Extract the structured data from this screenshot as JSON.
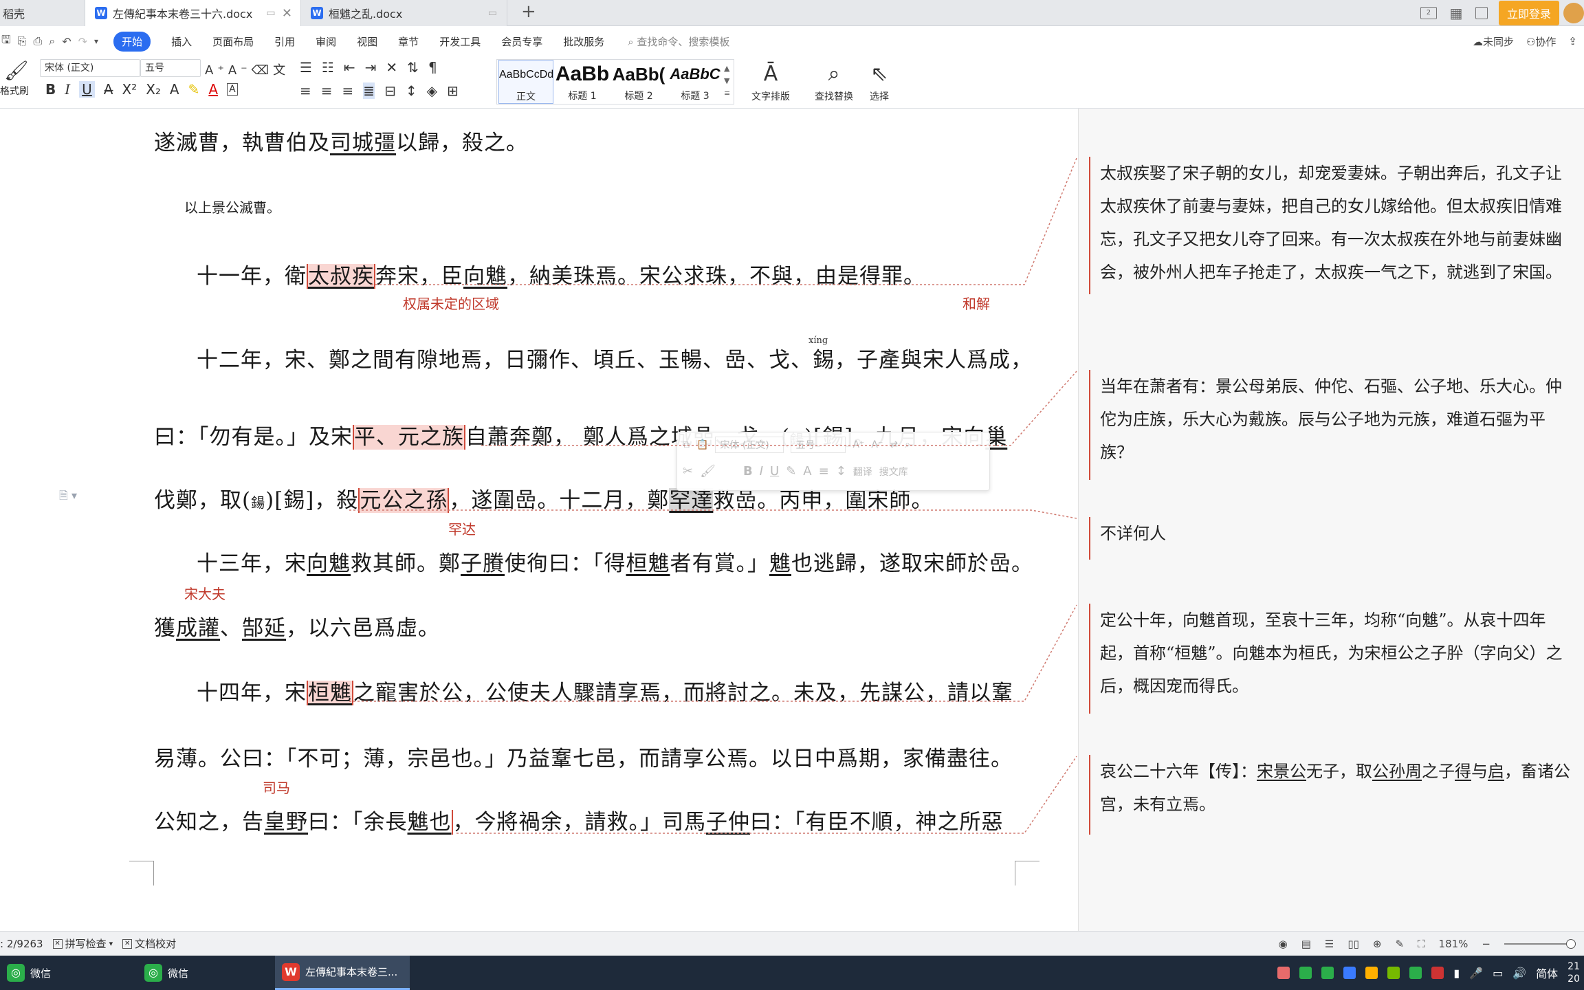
{
  "tabs": {
    "home_label": "稻壳",
    "doc1_label": "左傳紀事本末卷三十六.docx",
    "doc2_label": "桓魋之乱.docx",
    "new_tab": "+"
  },
  "titlebar": {
    "login_label": "立即登录",
    "layout_badge": "2"
  },
  "menu": {
    "items": [
      "开始",
      "插入",
      "页面布局",
      "引用",
      "审阅",
      "视图",
      "章节",
      "开发工具",
      "会员专享",
      "批改服务"
    ],
    "search_placeholder": "查找命令、搜索模板",
    "sync_label": "未同步",
    "collab_label": "协作"
  },
  "ribbon": {
    "format_painter": "格式刷",
    "font_name": "宋体 (正文)",
    "font_size": "五号",
    "styles": [
      {
        "preview": "AaBbCcDd",
        "name": "正文"
      },
      {
        "preview": "AaBb",
        "name": "标题 1"
      },
      {
        "preview": "AaBb(",
        "name": "标题 2"
      },
      {
        "preview": "AaBbC",
        "name": "标题 3"
      }
    ],
    "text_layout": "文字排版",
    "find_replace": "查找替换",
    "select": "选择"
  },
  "doc": {
    "l1_a": "遂滅曹，執曹伯及",
    "l1_u1": "司城彊",
    "l1_b": "以歸，殺之。",
    "note1": "以上景公滅曹。",
    "l2_a": "十一年，衛",
    "l2_h1": "太叔疾",
    "l2_b": "奔宋，臣",
    "l2_u1": "向魋",
    "l2_c": "，納美珠焉。宋公求珠，不與，由是得罪。",
    "anno_region": "权属未定的区域",
    "anno_peace": "和解",
    "l3_a": "十二年，宋、鄭之間有隙地焉，日彌作、頃丘、玉暢、嵒、戈、",
    "l3_b": "錫",
    "l3_c": "，子產與宋人爲成，",
    "ruby_xing": "xíng",
    "l4_a": "曰：「勿有是。」及宋",
    "l4_h1": "平、元之族",
    "l4_b": "自蕭奔鄭，  鄭人爲之城嵒、戈、(",
    "l4_small": "鍚",
    "l4_c": ")[錫]。九月，宋向",
    "l4_u1": "巢",
    "l5_a": "伐鄭，取(",
    "l5_small": "鍚",
    "l5_b": ")[錫]，殺",
    "l5_h1": "元公之孫",
    "l5_c": "，遂圍嵒。十二月，鄭",
    "l5_u1": "罕達",
    "l5_d": "救嵒。丙申，圍宋師。",
    "anno_handa": "罕达",
    "l6_a": "十三年，宋",
    "l6_u1": "向魋",
    "l6_b": "救其師。鄭",
    "l6_u2": "子賸",
    "l6_c": "使徇曰：「得",
    "l6_u3": "桓魋",
    "l6_d": "者有賞。」",
    "l6_u4": "魋",
    "l6_e": "也逃歸，遂取宋師於嵒。",
    "anno_song": "宋大夫",
    "l7_a": "獲",
    "l7_u1": "成讙",
    "l7_b": "、",
    "l7_u2": "郜延",
    "l7_c": "，以六邑爲虛。",
    "l8_a": "十四年，宋",
    "l8_h1": "桓魋",
    "l8_b": "之寵害於公，公使夫人驟請享焉，而將討之。未及，先謀公，請以鞌",
    "l9": "易薄。公曰：「不可；薄，宗邑也。」乃益鞌七邑，而請享公焉。以日中爲期，家備盡往。",
    "anno_sima": "司马",
    "l10_a": "公知之，告",
    "l10_u1": "皇野",
    "l10_b": "曰：「余長",
    "l10_u2": "魋也",
    "l10_c": "，今將禍余，請救。」司馬",
    "l10_u3": "子仲",
    "l10_d": "曰：「有臣不順，神之所惡"
  },
  "minibar": {
    "font": "宋体 (正文)",
    "size": "五号",
    "translate": "翻译",
    "search_lib": "搜文库"
  },
  "comments": {
    "c1": "太叔疾娶了宋子朝的女儿，却宠爱妻妹。子朝出奔后，孔文子让太叔疾休了前妻与妻妹，把自己的女儿嫁给他。但太叔疾旧情难忘，孔文子又把女儿夺了回来。有一次太叔疾在外地与前妻妹幽会，被外州人把车子抢走了，太叔疾一气之下，就逃到了宋国。",
    "c2": "当年在萧者有：景公母弟辰、仲佗、石彄、公子地、乐大心。仲佗为庄族，乐大心为戴族。辰与公子地为元族，难道石彄为平族？",
    "c3": "不详何人",
    "c4": "定公十年，向魋首现，至哀十三年，均称“向魋”。从哀十四年起，首称“桓魋”。向魋本为桓氏，为宋桓公之子肸（字向父）之后，概因宠而得氏。",
    "c5_a": "哀公二十六年【传】：",
    "c5_u1": "宋景公",
    "c5_b": "无子，取",
    "c5_u2": "公孙周",
    "c5_c": "之子",
    "c5_u3": "得",
    "c5_d": "与",
    "c5_u4": "启",
    "c5_e": "，畜诸公宫，未有立焉。"
  },
  "status": {
    "word_count": ": 2/9263",
    "spell_check": "拼写检查",
    "doc_proof": "文档校对",
    "zoom": "181%"
  },
  "taskbar": {
    "wechat1": "微信",
    "wechat2": "微信",
    "wps": "左傳紀事本末卷三...",
    "ime": "简体",
    "time": "21",
    "date": "20"
  }
}
